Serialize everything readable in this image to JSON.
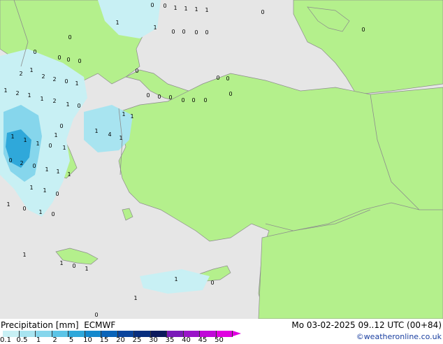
{
  "legend": {
    "title": "Precipitation [mm]",
    "model": "ECMWF",
    "datetime": "Mo 03-02-2025 09..12 UTC (00+84)",
    "credit": "©weatheronline.co.uk",
    "scale": [
      {
        "label": "0.1",
        "color": "#c8f0f4"
      },
      {
        "label": "0.5",
        "color": "#a8e4f0"
      },
      {
        "label": "1",
        "color": "#86d6ec"
      },
      {
        "label": "2",
        "color": "#5cc4e6"
      },
      {
        "label": "5",
        "color": "#2fa8da"
      },
      {
        "label": "10",
        "color": "#1488cc"
      },
      {
        "label": "15",
        "color": "#0a64b8"
      },
      {
        "label": "20",
        "color": "#0a449c"
      },
      {
        "label": "25",
        "color": "#082e7e"
      },
      {
        "label": "30",
        "color": "#0c1a5c"
      },
      {
        "label": "35",
        "color": "#7a1ab8"
      },
      {
        "label": "40",
        "color": "#9a14c8"
      },
      {
        "label": "45",
        "color": "#c00ad8"
      },
      {
        "label": "50",
        "color": "#e000e0"
      }
    ]
  },
  "map_colors": {
    "sea": "#e6e6e6",
    "land": "#b4f08c",
    "border": "#8c8c8c"
  },
  "value_labels": [
    "0",
    "0",
    "1",
    "1",
    "1",
    "1",
    "1",
    "0",
    "0",
    "0",
    "0",
    "0",
    "0",
    "0",
    "0",
    "0",
    "0",
    "0",
    "1",
    "0",
    "1",
    "2",
    "2",
    "2",
    "0",
    "1",
    "1",
    "2",
    "1",
    "1",
    "2",
    "1",
    "0",
    "0",
    "0",
    "0",
    "0",
    "0",
    "0",
    "0",
    "0",
    "0",
    "0",
    "1",
    "1",
    "1",
    "4",
    "1",
    "1",
    "1",
    "1",
    "0",
    "1",
    "2",
    "0",
    "1",
    "1",
    "1",
    "0",
    "1",
    "1",
    "0",
    "1",
    "0",
    "1",
    "0",
    "1",
    "1",
    "0",
    "1",
    "1",
    "0",
    "1",
    "0",
    "1"
  ]
}
